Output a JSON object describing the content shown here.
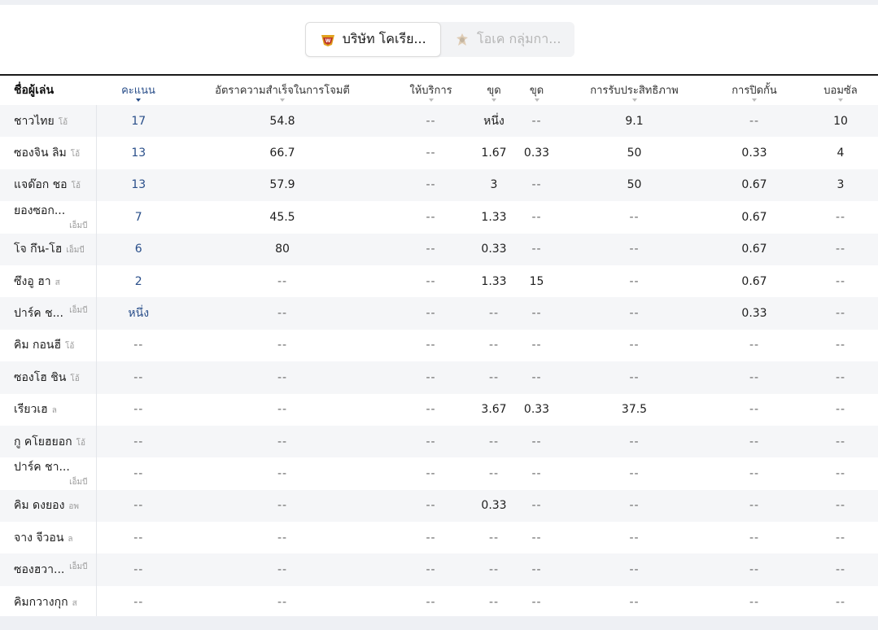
{
  "teams": [
    {
      "label": "บริษัท โคเรีย...",
      "active": true,
      "logo": "team-logo-icon"
    },
    {
      "label": "โอเค กลุ่มกา...",
      "active": false,
      "logo": "team-logo-icon"
    }
  ],
  "table": {
    "headers": [
      "ชื่อผู้เล่น",
      "คะแนน",
      "อัตราความสำเร็จในการโจมตี",
      "ให้บริการ",
      "ขุด",
      "ขุด",
      "การรับประสิทธิภาพ",
      "การปิดกั้น",
      "บอมซัล"
    ],
    "sorted_column_index": 1,
    "rows": [
      {
        "name": "ชาวไทย",
        "pos": "โอ้",
        "pos_align": "inline",
        "values": [
          "17",
          "54.8",
          "--",
          "หนึ่ง",
          "--",
          "9.1",
          "--",
          "10"
        ]
      },
      {
        "name": "ซองจิน ลิม",
        "pos": "โอ้",
        "pos_align": "inline",
        "values": [
          "13",
          "66.7",
          "--",
          "1.67",
          "0.33",
          "50",
          "0.33",
          "4"
        ]
      },
      {
        "name": "แจด๊อก ชอ",
        "pos": "โอ้",
        "pos_align": "inline",
        "values": [
          "13",
          "57.9",
          "--",
          "3",
          "--",
          "50",
          "0.67",
          "3"
        ]
      },
      {
        "name": "ยองซอก...",
        "pos": "เอ็มบี",
        "pos_align": "right",
        "values": [
          "7",
          "45.5",
          "--",
          "1.33",
          "--",
          "--",
          "0.67",
          "--"
        ]
      },
      {
        "name": "โจ กึน-โฮ",
        "pos": "เอ็มบี",
        "pos_align": "inline",
        "values": [
          "6",
          "80",
          "--",
          "0.33",
          "--",
          "--",
          "0.67",
          "--"
        ]
      },
      {
        "name": "ซึงอู ฮา",
        "pos": "ส",
        "pos_align": "inline",
        "values": [
          "2",
          "--",
          "--",
          "1.33",
          "15",
          "--",
          "0.67",
          "--"
        ]
      },
      {
        "name": "ปาร์ค ช...",
        "pos": "เอ็มบี",
        "pos_align": "right",
        "values": [
          "หนึ่ง",
          "--",
          "--",
          "--",
          "--",
          "--",
          "0.33",
          "--"
        ]
      },
      {
        "name": "คิม กอนฮี",
        "pos": "โอ้",
        "pos_align": "inline",
        "values": [
          "--",
          "--",
          "--",
          "--",
          "--",
          "--",
          "--",
          "--"
        ]
      },
      {
        "name": "ซองโฮ ชิน",
        "pos": "โอ้",
        "pos_align": "inline",
        "values": [
          "--",
          "--",
          "--",
          "--",
          "--",
          "--",
          "--",
          "--"
        ]
      },
      {
        "name": "เรียวเฮ",
        "pos": "ล",
        "pos_align": "inline",
        "values": [
          "--",
          "--",
          "--",
          "3.67",
          "0.33",
          "37.5",
          "--",
          "--"
        ]
      },
      {
        "name": "กู คโยฮยอก",
        "pos": "โอ้",
        "pos_align": "inline",
        "values": [
          "--",
          "--",
          "--",
          "--",
          "--",
          "--",
          "--",
          "--"
        ]
      },
      {
        "name": "ปาร์ค ชา...",
        "pos": "เอ็มบี",
        "pos_align": "right",
        "values": [
          "--",
          "--",
          "--",
          "--",
          "--",
          "--",
          "--",
          "--"
        ]
      },
      {
        "name": "คิม ดงยอง",
        "pos": "อพ",
        "pos_align": "inline",
        "values": [
          "--",
          "--",
          "--",
          "0.33",
          "--",
          "--",
          "--",
          "--"
        ]
      },
      {
        "name": "จาง จีวอน",
        "pos": "ล",
        "pos_align": "inline",
        "values": [
          "--",
          "--",
          "--",
          "--",
          "--",
          "--",
          "--",
          "--"
        ]
      },
      {
        "name": "ซองฮวา...",
        "pos": "เอ็มบี",
        "pos_align": "right",
        "values": [
          "--",
          "--",
          "--",
          "--",
          "--",
          "--",
          "--",
          "--"
        ]
      },
      {
        "name": "คิมกวางกุก",
        "pos": "ส",
        "pos_align": "inline",
        "values": [
          "--",
          "--",
          "--",
          "--",
          "--",
          "--",
          "--",
          "--"
        ]
      }
    ]
  }
}
